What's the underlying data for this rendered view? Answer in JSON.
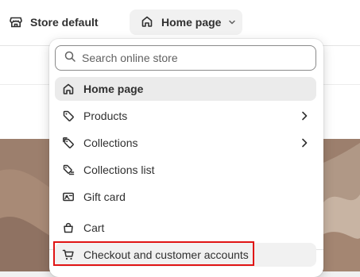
{
  "topbar": {
    "store_name": "Store default",
    "page_selector": "Home page"
  },
  "menu": {
    "search_placeholder": "Search online store",
    "items": [
      {
        "label": "Home page",
        "icon": "home-icon",
        "active": true
      },
      {
        "label": "Products",
        "icon": "tag-icon",
        "has_submenu": true
      },
      {
        "label": "Collections",
        "icon": "collections-tag-icon",
        "has_submenu": true
      },
      {
        "label": "Collections list",
        "icon": "collections-list-icon"
      },
      {
        "label": "Gift card",
        "icon": "gift-card-icon"
      },
      {
        "label": "Cart",
        "icon": "bag-icon"
      },
      {
        "label": "Checkout and customer accounts",
        "icon": "cart-icon",
        "highlighted": true
      }
    ]
  },
  "colors": {
    "highlight_border": "#e01414",
    "active_item_bg": "#ebebeb",
    "hover_item_bg": "#f1f1f1"
  }
}
